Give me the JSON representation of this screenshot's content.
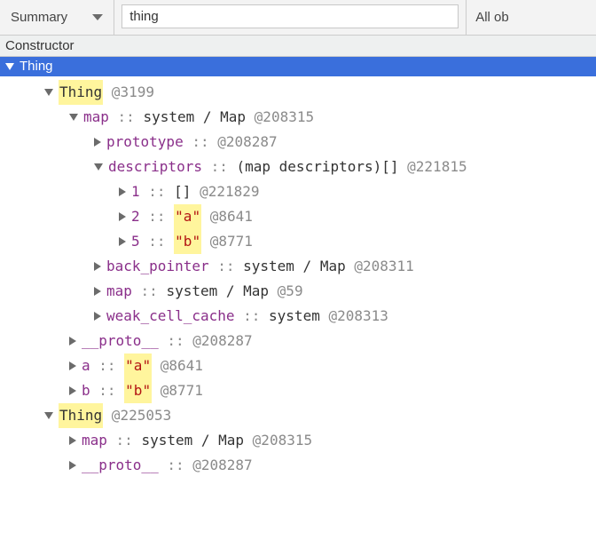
{
  "toolbar": {
    "dropdown_label": "Summary",
    "filter_value": "thing",
    "right_label": "All ob"
  },
  "header": {
    "constructor_label": "Constructor"
  },
  "selected": {
    "label": "Thing"
  },
  "lines": [
    {
      "indent": 1,
      "arrow": "down",
      "parts": [
        {
          "t": "hl",
          "v": "Thing"
        },
        {
          "t": "grey",
          "v": " @3199"
        }
      ]
    },
    {
      "indent": 2,
      "arrow": "down",
      "parts": [
        {
          "t": "purple",
          "v": "map"
        },
        {
          "t": "grey",
          "v": " :: "
        },
        {
          "t": "plain",
          "v": "system / Map "
        },
        {
          "t": "grey",
          "v": "@208315"
        }
      ]
    },
    {
      "indent": 3,
      "arrow": "right",
      "parts": [
        {
          "t": "purple",
          "v": "prototype"
        },
        {
          "t": "grey",
          "v": " :: "
        },
        {
          "t": "grey",
          "v": "@208287"
        }
      ]
    },
    {
      "indent": 3,
      "arrow": "down",
      "parts": [
        {
          "t": "purple",
          "v": "descriptors"
        },
        {
          "t": "grey",
          "v": " :: "
        },
        {
          "t": "plain",
          "v": "(map descriptors)[] "
        },
        {
          "t": "grey",
          "v": "@221815"
        }
      ]
    },
    {
      "indent": 4,
      "arrow": "right",
      "parts": [
        {
          "t": "purple",
          "v": "1"
        },
        {
          "t": "grey",
          "v": " :: "
        },
        {
          "t": "plain",
          "v": "[] "
        },
        {
          "t": "grey",
          "v": "@221829"
        }
      ]
    },
    {
      "indent": 4,
      "arrow": "right",
      "parts": [
        {
          "t": "purple",
          "v": "2"
        },
        {
          "t": "grey",
          "v": " :: "
        },
        {
          "t": "red",
          "v": "\"a\""
        },
        {
          "t": "grey",
          "v": " @8641"
        }
      ]
    },
    {
      "indent": 4,
      "arrow": "right",
      "parts": [
        {
          "t": "purple",
          "v": "5"
        },
        {
          "t": "grey",
          "v": " :: "
        },
        {
          "t": "red",
          "v": "\"b\""
        },
        {
          "t": "grey",
          "v": " @8771"
        }
      ]
    },
    {
      "indent": 3,
      "arrow": "right",
      "parts": [
        {
          "t": "purple",
          "v": "back_pointer"
        },
        {
          "t": "grey",
          "v": " :: "
        },
        {
          "t": "plain",
          "v": "system / Map "
        },
        {
          "t": "grey",
          "v": "@208311"
        }
      ]
    },
    {
      "indent": 3,
      "arrow": "right",
      "parts": [
        {
          "t": "purple",
          "v": "map"
        },
        {
          "t": "grey",
          "v": " :: "
        },
        {
          "t": "plain",
          "v": "system / Map "
        },
        {
          "t": "grey",
          "v": "@59"
        }
      ]
    },
    {
      "indent": 3,
      "arrow": "right",
      "parts": [
        {
          "t": "purple",
          "v": "weak_cell_cache"
        },
        {
          "t": "grey",
          "v": " :: "
        },
        {
          "t": "plain",
          "v": "system "
        },
        {
          "t": "grey",
          "v": "@208313"
        }
      ]
    },
    {
      "indent": 2,
      "arrow": "right",
      "parts": [
        {
          "t": "purple",
          "v": "__proto__"
        },
        {
          "t": "grey",
          "v": " :: "
        },
        {
          "t": "grey",
          "v": "@208287"
        }
      ]
    },
    {
      "indent": 2,
      "arrow": "right",
      "parts": [
        {
          "t": "purple",
          "v": "a"
        },
        {
          "t": "grey",
          "v": " :: "
        },
        {
          "t": "red",
          "v": "\"a\""
        },
        {
          "t": "grey",
          "v": " @8641"
        }
      ]
    },
    {
      "indent": 2,
      "arrow": "right",
      "parts": [
        {
          "t": "purple",
          "v": "b"
        },
        {
          "t": "grey",
          "v": " :: "
        },
        {
          "t": "red",
          "v": "\"b\""
        },
        {
          "t": "grey",
          "v": " @8771"
        }
      ]
    },
    {
      "indent": 1,
      "arrow": "down",
      "parts": [
        {
          "t": "hl",
          "v": "Thing"
        },
        {
          "t": "grey",
          "v": " @225053"
        }
      ]
    },
    {
      "indent": 2,
      "arrow": "right",
      "parts": [
        {
          "t": "purple",
          "v": "map"
        },
        {
          "t": "grey",
          "v": " :: "
        },
        {
          "t": "plain",
          "v": "system / Map "
        },
        {
          "t": "grey",
          "v": "@208315"
        }
      ]
    },
    {
      "indent": 2,
      "arrow": "right",
      "parts": [
        {
          "t": "purple",
          "v": "__proto__"
        },
        {
          "t": "grey",
          "v": " :: "
        },
        {
          "t": "grey",
          "v": "@208287"
        }
      ]
    }
  ]
}
